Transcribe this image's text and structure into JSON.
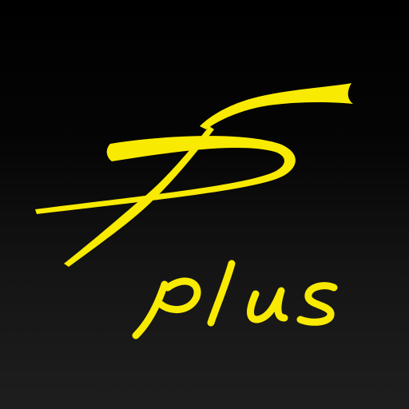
{
  "app_icon": {
    "logo_text": "plus",
    "brand_color": "#F8EA00",
    "background_colors": [
      "#000000",
      "#1e1e1e"
    ],
    "icon_name": "fs-plus-logo-icon"
  }
}
